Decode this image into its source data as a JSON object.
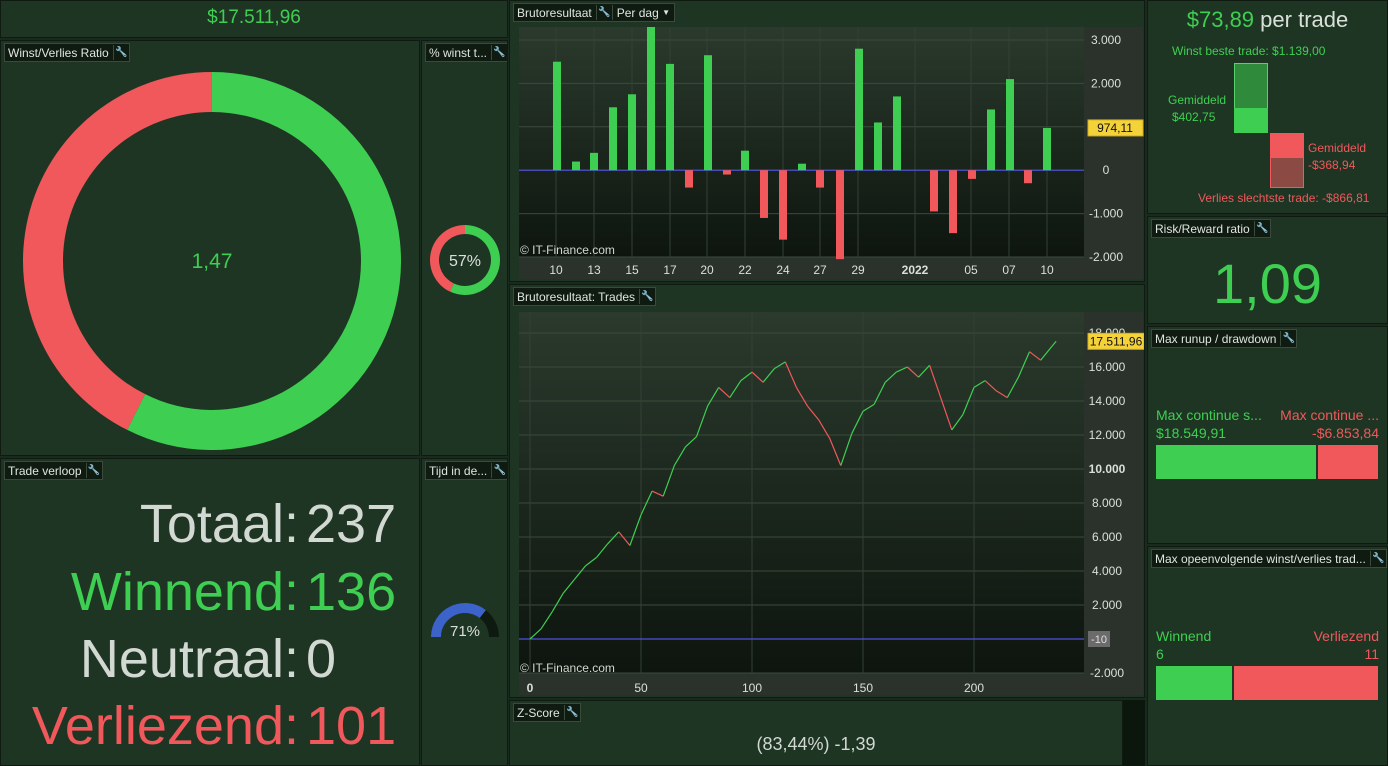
{
  "top_total": {
    "value": "$17.511,96"
  },
  "winloss": {
    "title": "Winst/Verlies Ratio",
    "center": "1,47",
    "win_fraction": 0.574,
    "colors": {
      "win": "#3ecf52",
      "loss": "#f0585c"
    }
  },
  "winpct": {
    "title": "% winst t...",
    "label": "57%",
    "fraction": 0.57
  },
  "time_in": {
    "title": "Tijd in de...",
    "label": "71%",
    "fraction": 0.71,
    "color": "#3b63c9"
  },
  "trade_verloop": {
    "title": "Trade verloop",
    "rows": [
      {
        "label": "Totaal:",
        "value": "237"
      },
      {
        "label": "Winnend:",
        "value": "136"
      },
      {
        "label": "Neutraal:",
        "value": "0"
      },
      {
        "label": "Verliezend:",
        "value": "101"
      }
    ]
  },
  "bar_chart": {
    "title": "Brutoresultaat",
    "dropdown": "Per dag",
    "watermark": "© IT-Finance.com",
    "last_value": "974,11",
    "y_ticks": [
      "3.000",
      "2.000",
      "1.000",
      "0",
      "-1.000",
      "-2.000"
    ],
    "x_ticks": [
      "10",
      "13",
      "15",
      "17",
      "20",
      "22",
      "24",
      "27",
      "29",
      "2022",
      "05",
      "07",
      "10"
    ]
  },
  "line_chart": {
    "title": "Brutoresultaat: Trades",
    "watermark": "© IT-Finance.com",
    "last_value": "17.511,96",
    "end_label": "-10",
    "y_ticks": [
      "18.000",
      "16.000",
      "14.000",
      "12.000",
      "10.000",
      "8.000",
      "6.000",
      "4.000",
      "2.000",
      "-2.000"
    ],
    "x_ticks": [
      "0",
      "50",
      "100",
      "150",
      "200"
    ]
  },
  "chart_data": [
    {
      "type": "bar",
      "title": "Brutoresultaat",
      "ylim": [
        -2000,
        3300
      ],
      "values": [
        2500,
        200,
        400,
        1450,
        1750,
        3300,
        2450,
        -400,
        2650,
        -100,
        450,
        -1100,
        -1600,
        150,
        -400,
        -2050,
        2800,
        1100,
        1700,
        -950,
        -1450,
        -200,
        1400,
        2100,
        -300,
        974.11
      ],
      "colors": {
        "positive": "#3ecf52",
        "negative": "#f0585c"
      }
    },
    {
      "type": "line",
      "title": "Brutoresultaat: Trades",
      "xlim": [
        0,
        237
      ],
      "ylim": [
        -2000,
        18000
      ],
      "x": [
        0,
        5,
        10,
        15,
        20,
        25,
        30,
        35,
        40,
        45,
        50,
        55,
        60,
        65,
        70,
        75,
        80,
        85,
        90,
        95,
        100,
        105,
        110,
        115,
        120,
        125,
        130,
        135,
        140,
        145,
        150,
        155,
        160,
        165,
        170,
        175,
        180,
        185,
        190,
        195,
        200,
        205,
        210,
        215,
        220,
        225,
        230,
        235,
        237
      ],
      "y": [
        0,
        600,
        1600,
        2700,
        3500,
        4300,
        4800,
        5600,
        6300,
        5500,
        7300,
        8700,
        8400,
        10200,
        11300,
        11900,
        13700,
        14800,
        14200,
        15200,
        15700,
        15100,
        15900,
        16300,
        14800,
        13700,
        12900,
        11800,
        10200,
        12100,
        13400,
        13800,
        15100,
        15700,
        16000,
        15400,
        16100,
        14200,
        12300,
        13200,
        14800,
        15200,
        14600,
        14200,
        15400,
        16900,
        16400,
        17200,
        17512
      ],
      "colors": {
        "up": "#3ecf52",
        "down": "#f0585c"
      }
    }
  ],
  "per_trade": {
    "value": "$73,89",
    "suffix": "per trade",
    "best_label": "Winst beste trade: $1.139,00",
    "avg_win_label": "Gemiddeld",
    "avg_win_value": "$402,75",
    "avg_loss_label": "Gemiddeld",
    "avg_loss_value": "-$368,94",
    "worst_label": "Verlies slechtste trade: -$866,81"
  },
  "risk_reward": {
    "title": "Risk/Reward ratio",
    "value": "1,09"
  },
  "runup": {
    "title": "Max runup / drawdown",
    "left_label": "Max continue s...",
    "right_label": "Max continue ...",
    "left_value": "$18.549,91",
    "right_value": "-$6.853,84",
    "left_fraction": 0.73
  },
  "streak": {
    "title": "Max opeenvolgende winst/verlies trad...",
    "left_label": "Winnend",
    "right_label": "Verliezend",
    "left_value": "6",
    "right_value": "11",
    "left_fraction": 0.353
  },
  "zscore": {
    "title": "Z-Score",
    "value": "(83,44%) -1,39"
  }
}
